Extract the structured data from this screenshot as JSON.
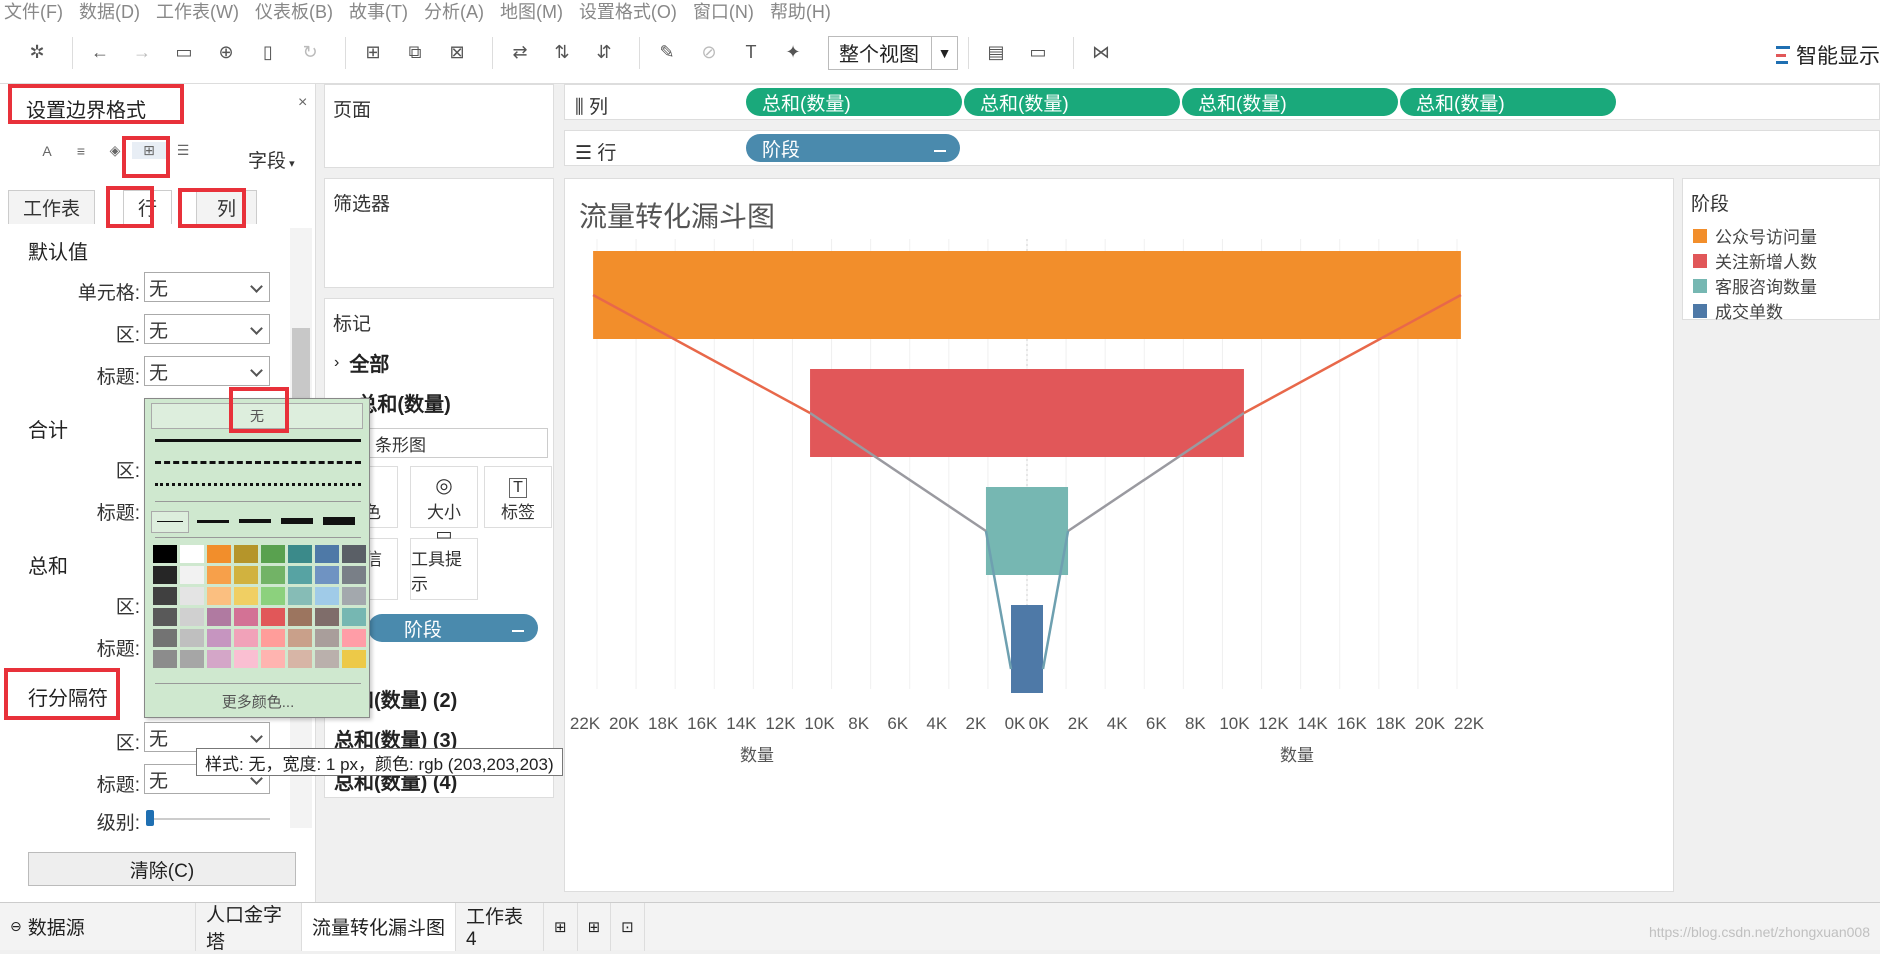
{
  "menu": [
    "文件(F)",
    "数据(D)",
    "工作表(W)",
    "仪表板(B)",
    "故事(T)",
    "分析(A)",
    "地图(M)",
    "设置格式(O)",
    "窗口(N)",
    "帮助(H)"
  ],
  "toolbar": {
    "view_fit": "整个视图",
    "smart_show": "智能显示"
  },
  "format_pane": {
    "title": "设置边界格式",
    "close": "×",
    "fields_dropdown": "字段",
    "tabs": [
      "工作表",
      "行",
      "列"
    ],
    "sections": {
      "default": "默认值",
      "subtotal": "合计",
      "grand_total": "总和",
      "row_divider": "行分隔符"
    },
    "labels": {
      "cell": "单元格:",
      "pane": "区:",
      "header": "标题:",
      "level": "级别:"
    },
    "values": {
      "cell": "无",
      "pane": "无",
      "header": "无",
      "divider_pane": "无",
      "divider_header": "无"
    },
    "clear": "清除(C)"
  },
  "popup": {
    "none": "无",
    "more_colors": "更多颜色...",
    "swatches": [
      "#000000",
      "#ffffff",
      "#f28e2b",
      "#b5952a",
      "#59a14f",
      "#3b8a8a",
      "#4e79a7",
      "#5a5f66",
      "#262626",
      "#f2f2f2",
      "#f7a04a",
      "#d1b23f",
      "#72b366",
      "#57a3a3",
      "#6f93c2",
      "#797f87",
      "#404040",
      "#e4e4e4",
      "#fbbf80",
      "#f0cf63",
      "#8cd17d",
      "#86bcb6",
      "#a0cbe8",
      "#a3a8ad",
      "#595959",
      "#d0d0d0",
      "#b07aa1",
      "#d37295",
      "#e15759",
      "#9c755f",
      "#7f6d6a",
      "#76b7b2",
      "#737373",
      "#bfbfbf",
      "#c695c0",
      "#f1a2b9",
      "#ff9d9a",
      "#c9a08a",
      "#a99e9b",
      "#ff9da7",
      "#8c8c8c",
      "#a6a6a6",
      "#d4a6c8",
      "#fabfd2",
      "#ffb4b0",
      "#d7b5a6",
      "#bab0ac",
      "#edc948"
    ]
  },
  "tooltip": "样式: 无，宽度: 1 px，颜色: rgb (203,203,203)",
  "cards": {
    "pages": "页面",
    "filters": "筛选器",
    "marks": "标记",
    "all": "全部",
    "sum1": "总和(数量)",
    "mark_type": "条形图",
    "color": "颜色",
    "size": "大小",
    "label": "标签",
    "detail": "详细信息",
    "tooltip": "工具提示",
    "stage": "阶段",
    "sum2": "总和(数量) (2)",
    "sum3": "总和(数量) (3)",
    "sum4": "总和(数量) (4)"
  },
  "shelves": {
    "columns_label": "列",
    "rows_label": "行",
    "column_pills": [
      "总和(数量)",
      "总和(数量)",
      "总和(数量)",
      "总和(数量)"
    ],
    "row_pill": "阶段"
  },
  "chart": {
    "title": "流量转化漏斗图",
    "xlabel_left": "数量",
    "xlabel_right": "数量",
    "ticks_left": [
      "22K",
      "20K",
      "18K",
      "16K",
      "14K",
      "12K",
      "10K",
      "8K",
      "6K",
      "4K",
      "2K",
      "0K"
    ],
    "ticks_right": [
      "0K",
      "2K",
      "4K",
      "6K",
      "8K",
      "10K",
      "12K",
      "14K",
      "16K",
      "18K",
      "20K",
      "22K"
    ]
  },
  "chart_data": {
    "type": "bar",
    "title": "流量转化漏斗图",
    "xlabel": "数量",
    "categories": [
      "公众号访问量",
      "关注新增人数",
      "客服咨询数量",
      "成交单数"
    ],
    "values": [
      22200,
      11100,
      2100,
      400
    ],
    "colors": [
      "#f28e2b",
      "#e15759",
      "#76b7b2",
      "#4e79a7"
    ],
    "xlim": [
      0,
      22000
    ],
    "mirrored": true,
    "legend_title": "阶段",
    "legend_position": "right"
  },
  "legend": {
    "title": "阶段"
  },
  "bottom_tabs": [
    "数据源",
    "人口金字塔",
    "流量转化漏斗图",
    "工作表4"
  ],
  "watermark": "https://blog.csdn.net/zhongxuan008"
}
